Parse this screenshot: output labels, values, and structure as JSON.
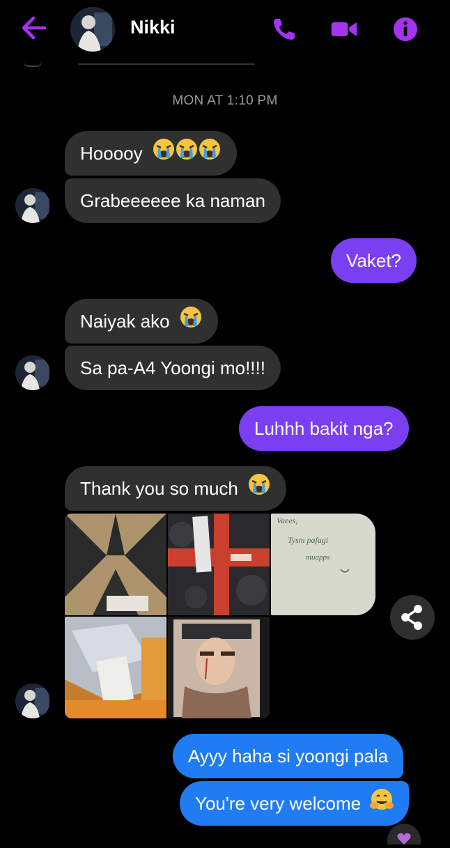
{
  "header": {
    "contact_name": "Nikki",
    "icons": [
      "back-arrow-icon",
      "phone-icon",
      "video-camera-icon",
      "info-icon"
    ],
    "accent_color": "#a433f2"
  },
  "timestamp": "MON AT 1:10 PM",
  "messages": [
    {
      "from": "Nikki",
      "text": "Hooooy"
    },
    {
      "from": "Nikki",
      "text": "Grabeeeeee ka naman"
    },
    {
      "from": "me",
      "text": "Vaket?"
    },
    {
      "from": "Nikki",
      "text": "Naiyak ako"
    },
    {
      "from": "Nikki",
      "text": "Sa pa-A4 Yoongi mo!!!!"
    },
    {
      "from": "me",
      "text": "Luhhh bakit nga?"
    },
    {
      "from": "Nikki",
      "text": "Thank you so much"
    },
    {
      "from": "me",
      "text": "Ayyy haha si yoongi pala"
    },
    {
      "from": "me",
      "text": "You're very welcome"
    }
  ],
  "photo_note": {
    "line1": "Vaees,",
    "line2": "Tysm pafagi",
    "line3": "muapps"
  },
  "colors": {
    "incoming_bubble": "#303030",
    "outgoing_purple": "#7b3ff2",
    "outgoing_blue": "#1f7cf2",
    "background": "#000000"
  }
}
